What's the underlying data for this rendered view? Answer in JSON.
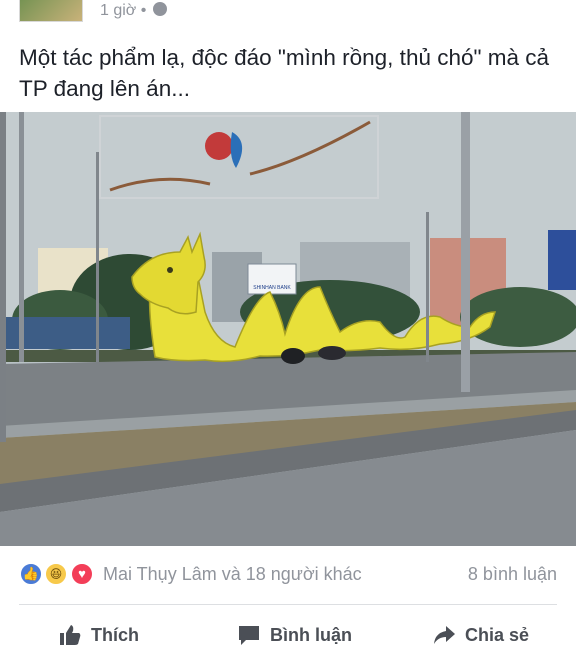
{
  "post": {
    "time": "1 giờ",
    "separator": "•",
    "caption": "Một tác phẩm lạ, độc đáo \"mình rồng, thủ chó\" mà cả TP đang lên án..."
  },
  "photo": {
    "sign_text": "SHINHAN BANK"
  },
  "reactions": {
    "icons": [
      "like-icon",
      "haha-icon",
      "love-icon"
    ],
    "names_text": "Mai Thụy Lâm và 18 người khác",
    "comments_text": "8 bình luận"
  },
  "actions": {
    "like_label": "Thích",
    "comment_label": "Bình luận",
    "share_label": "Chia sẻ"
  },
  "colors": {
    "like_blue": "#4a7bd6",
    "haha_yellow": "#f7c94a",
    "love_red": "#f33e58",
    "action_gray": "#4b4f56",
    "meta_gray": "#90949c"
  }
}
